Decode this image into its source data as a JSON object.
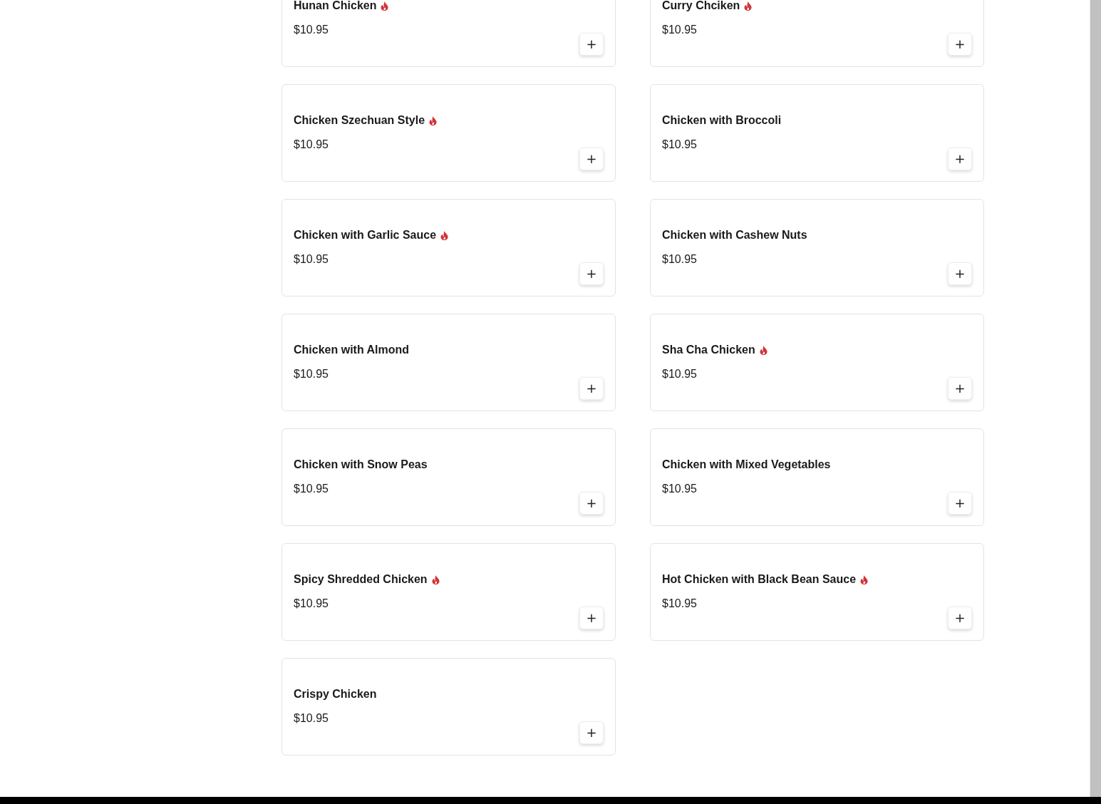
{
  "menu_items": [
    {
      "name": "Hunan Chicken",
      "spicy": true,
      "price": "$10.95",
      "add": "+"
    },
    {
      "name": "Curry Chciken",
      "spicy": true,
      "price": "$10.95",
      "add": "+"
    },
    {
      "name": "Chicken Szechuan Style",
      "spicy": true,
      "price": "$10.95",
      "add": "+"
    },
    {
      "name": "Chicken with Broccoli",
      "spicy": false,
      "price": "$10.95",
      "add": "+"
    },
    {
      "name": "Chicken with Garlic Sauce",
      "spicy": true,
      "price": "$10.95",
      "add": "+"
    },
    {
      "name": "Chicken with Cashew Nuts",
      "spicy": false,
      "price": "$10.95",
      "add": "+"
    },
    {
      "name": "Chicken with Almond",
      "spicy": false,
      "price": "$10.95",
      "add": "+"
    },
    {
      "name": "Sha Cha Chicken",
      "spicy": true,
      "price": "$10.95",
      "add": "+"
    },
    {
      "name": "Chicken with Snow Peas",
      "spicy": false,
      "price": "$10.95",
      "add": "+"
    },
    {
      "name": "Chicken with Mixed Vegetables",
      "spicy": false,
      "price": "$10.95",
      "add": "+"
    },
    {
      "name": "Spicy Shredded Chicken",
      "spicy": true,
      "price": "$10.95",
      "add": "+"
    },
    {
      "name": "Hot Chicken with Black Bean Sauce",
      "spicy": true,
      "price": "$10.95",
      "add": "+"
    },
    {
      "name": "Crispy Chicken",
      "spicy": false,
      "price": "$10.95",
      "add": "+"
    }
  ]
}
